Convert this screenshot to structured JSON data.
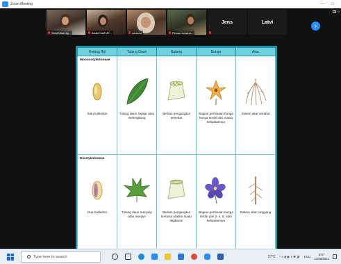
{
  "window": {
    "app_title": "Zoom Meeting",
    "controls": [
      "—",
      "□"
    ]
  },
  "meeting": {
    "view_label": "Vi",
    "participants": [
      {
        "name": "Sinta Dilah Ay...",
        "muted": true
      },
      {
        "name": "Abdul Latif MT...",
        "muted": true
      },
      {
        "name": "danisha",
        "muted": true
      },
      {
        "name": "Firman Ikmana...",
        "muted": true
      },
      {
        "name": "Jens",
        "muted": true
      },
      {
        "name": "Latvi",
        "muted": false
      }
    ],
    "next_icon": "›"
  },
  "slide": {
    "headers": [
      "Keping Biji",
      "Tulang Daun",
      "Batang",
      "Bunga",
      "Akar"
    ],
    "groups": [
      {
        "label": "Monocotyledoneae",
        "captions": [
          "Satu kotiledon",
          "Tulang daun sejajar atau melengkung",
          "Berkas pengangkut tersebar",
          "Bagian perhiasan bunga hanya terdiri dari 3 atau kelipatannya",
          "Sistem akar serabut"
        ]
      },
      {
        "label": "Dicotyledoneae",
        "captions": [
          "Dua kotiledon",
          "Tulang daun menyirip atau menjari",
          "Berkas pengangkut tersusun dalam suatu lingkaran",
          "Bagian perhiasan bunga terdiri dari 2, 4, 5, atau kelipatannya",
          "Sistem akar tunggang"
        ]
      }
    ]
  },
  "taskbar": {
    "search_placeholder": "Type here to search",
    "weather": "27°C",
    "lang": "ENG",
    "time": "9:57",
    "date": "13/08/2021"
  }
}
